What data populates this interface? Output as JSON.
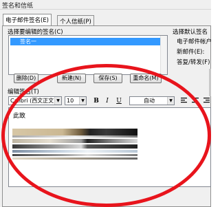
{
  "window": {
    "title": "签名和信纸"
  },
  "tabs": [
    {
      "label": "电子邮件签名(E)",
      "active": true
    },
    {
      "label": "个人信纸(P)",
      "active": false
    }
  ],
  "signature_section": {
    "label": "选择要编辑的签名(C)",
    "selected_item": "签名一"
  },
  "buttons": {
    "delete": "删除(D)",
    "new": "新建(N)",
    "save": "保存(S)",
    "rename": "重命名(M)"
  },
  "default_signature": {
    "label": "选择默认签名",
    "account_label": "电子邮件帐户",
    "new_messages_label": "新邮件(E):",
    "replies_label": "答复/转发(F)"
  },
  "editor": {
    "label": "编辑签名(T)",
    "font_value": "Calibri (西文正文)",
    "size_value": "10",
    "bold_icon": "B",
    "italic_icon": "I",
    "underline_icon": "U",
    "color_value": "自动",
    "content_text": "此致"
  },
  "colors": {
    "annotation": "#e8141c",
    "selection": "#3399ff"
  }
}
